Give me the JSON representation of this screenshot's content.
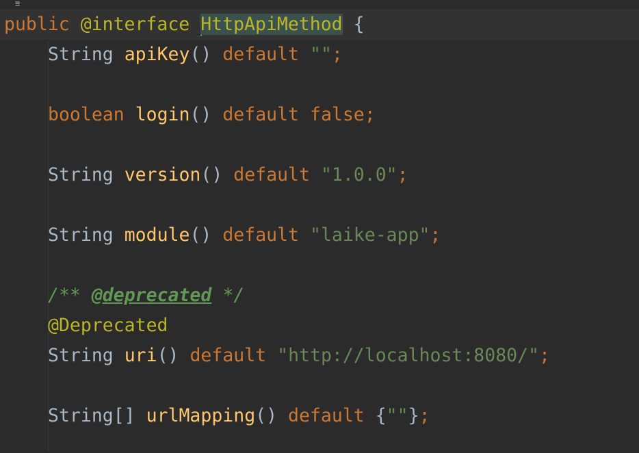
{
  "colors": {
    "background": "#2b2b2b",
    "keyword": "#cc7832",
    "annotation": "#bbb529",
    "method": "#ffc66d",
    "string": "#6a8759",
    "comment": "#629755",
    "plain": "#a9b7c6"
  },
  "code": {
    "l1": {
      "kw1": "public",
      "ann": "@interface",
      "name": "HttpApiMethod",
      "brace": "{"
    },
    "l2": {
      "type": "String",
      "method": "apiKey",
      "parens": "()",
      "kw": "default",
      "value": "\"\"",
      "end": ";"
    },
    "l3": {
      "type": "boolean",
      "method": "login",
      "parens": "()",
      "kw": "default",
      "value": "false",
      "end": ";"
    },
    "l4": {
      "type": "String",
      "method": "version",
      "parens": "()",
      "kw": "default",
      "value": "\"1.0.0\"",
      "end": ";"
    },
    "l5": {
      "type": "String",
      "method": "module",
      "parens": "()",
      "kw": "default",
      "value": "\"laike-app\"",
      "end": ";"
    },
    "l6": {
      "open": "/**",
      "tag": "@deprecated",
      "close": "*/"
    },
    "l7": {
      "ann": "@Deprecated"
    },
    "l8": {
      "type": "String",
      "method": "uri",
      "parens": "()",
      "kw": "default",
      "value": "\"http://localhost:8080/\"",
      "end": ";"
    },
    "l9": {
      "type": "String[]",
      "method": "urlMapping",
      "parens": "()",
      "kw": "default",
      "open": "{",
      "value": "\"\"",
      "close": "}",
      "end": ";"
    }
  }
}
